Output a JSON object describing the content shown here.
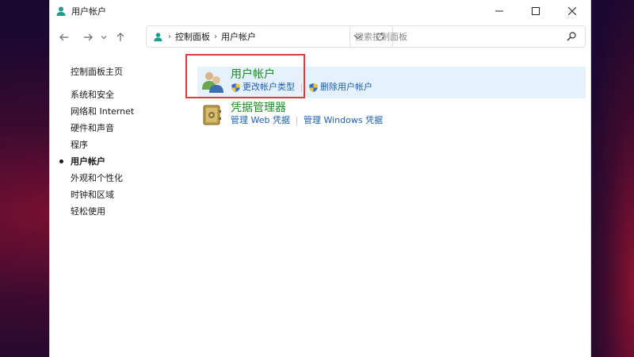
{
  "window": {
    "title": "用户帐户"
  },
  "address": {
    "crumbs": [
      "控制面板",
      "用户帐户"
    ]
  },
  "search": {
    "placeholder": "搜索控制面板"
  },
  "sidebar": {
    "items": [
      {
        "label": "控制面板主页",
        "active": false
      },
      {
        "label": "系统和安全",
        "active": false
      },
      {
        "label": "网络和 Internet",
        "active": false
      },
      {
        "label": "硬件和声音",
        "active": false
      },
      {
        "label": "程序",
        "active": false
      },
      {
        "label": "用户帐户",
        "active": true
      },
      {
        "label": "外观和个性化",
        "active": false
      },
      {
        "label": "时钟和区域",
        "active": false
      },
      {
        "label": "轻松使用",
        "active": false
      }
    ]
  },
  "categories": [
    {
      "title": "用户帐户",
      "icon": "users-icon",
      "links": [
        "更改帐户类型",
        "删除用户帐户"
      ]
    },
    {
      "title": "凭据管理器",
      "icon": "vault-icon",
      "links": [
        "管理 Web 凭据",
        "管理 Windows 凭据"
      ]
    }
  ],
  "colors": {
    "category_title": "#1e8a24",
    "link": "#1a5fb4",
    "highlight": "#e5f1fb",
    "annotation_box": "#e03a3a"
  }
}
